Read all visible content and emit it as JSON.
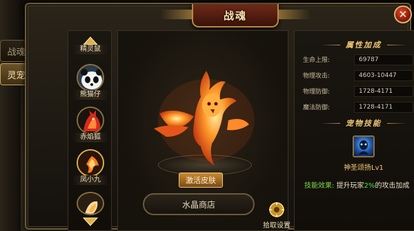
{
  "window": {
    "title": "战魂",
    "close_label": "✕"
  },
  "side_tabs": [
    {
      "label": "战魂",
      "active": false
    },
    {
      "label": "灵宠",
      "active": true
    }
  ],
  "pet_list": [
    {
      "name": "精灵鼠"
    },
    {
      "name": "熊猫仔"
    },
    {
      "name": "赤焰狐"
    },
    {
      "name": "凤小九"
    }
  ],
  "stage": {
    "activate_skin": "激活皮肤",
    "crystal_shop": "水晶商店",
    "pickup_settings": "拾取设置"
  },
  "attributes": {
    "title": "属性加成",
    "rows": [
      {
        "label": "生命上限:",
        "value": "69787"
      },
      {
        "label": "物理攻击:",
        "value": "4603-10447"
      },
      {
        "label": "物理防御:",
        "value": "1728-4171"
      },
      {
        "label": "魔法防御:",
        "value": "1728-4171"
      }
    ]
  },
  "skills": {
    "title": "宠物技能",
    "skill_name": "神圣颂扬Lv1",
    "effect_key": "技能效果:",
    "effect_text_a": "提升玩家",
    "effect_pct": "2%",
    "effect_text_b": "的攻击加成"
  },
  "colors": {
    "accent": "#f0c774",
    "frame": "#6b5a3a",
    "highlight_green": "#4ee04a"
  }
}
